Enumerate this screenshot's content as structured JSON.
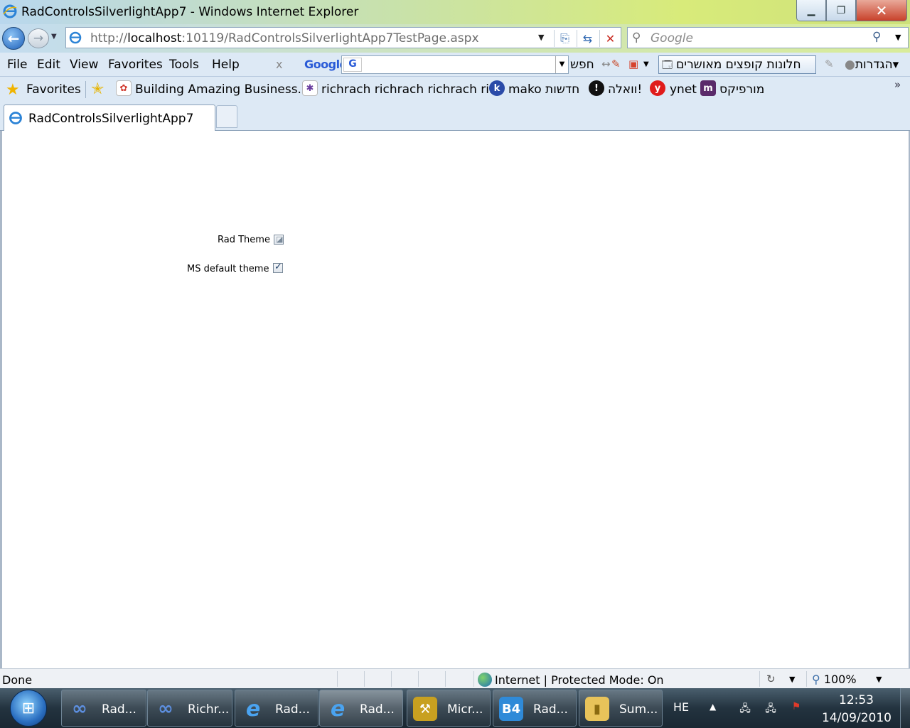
{
  "window": {
    "title": "RadControlsSilverlightApp7 - Windows Internet Explorer",
    "minimize_glyph": "▁",
    "maximize_glyph": "❐",
    "close_glyph": "✕"
  },
  "address_bar": {
    "url_prefix": "http://",
    "url_host": "localhost",
    "url_rest": ":10119/RadControlsSilverlightApp7TestPage.aspx",
    "search_placeholder": "Google"
  },
  "menu": {
    "items": [
      "File",
      "Edit",
      "View",
      "Favorites",
      "Tools",
      "Help"
    ]
  },
  "google_toolbar": {
    "close": "x",
    "logo": "Google",
    "search_label": "חפש",
    "popup_blocker": "חלונות קופצים מאושרים",
    "settings": "הגדרות"
  },
  "favorites_bar": {
    "label": "Favorites",
    "items": [
      {
        "label": "Building Amazing Business...",
        "icon": "page-icon",
        "color": "#d13a2f"
      },
      {
        "label": "richrach richrach richrach ri...",
        "icon": "puzzle-icon",
        "color": "#6b3fa0"
      },
      {
        "label": "mako חדשות",
        "icon": "mako-icon",
        "color": "#2a4aa8"
      },
      {
        "label": "וואלה!",
        "icon": "walla-icon",
        "color": "#111111"
      },
      {
        "label": "ynet",
        "icon": "ynet-icon",
        "color": "#e01b1b"
      },
      {
        "label": "מורפיקס",
        "icon": "morfix-icon",
        "color": "#5a2a6a"
      }
    ]
  },
  "tabs": [
    {
      "title": "RadControlsSilverlightApp7"
    }
  ],
  "content": {
    "options": [
      {
        "label": "Rad Theme",
        "checked": false
      },
      {
        "label": "MS default theme",
        "checked": true
      }
    ]
  },
  "status_bar": {
    "status": "Done",
    "zone": "Internet | Protected Mode: On",
    "zoom": "100%"
  },
  "taskbar": {
    "buttons": [
      {
        "label": "Rad...",
        "icon": "visual-studio-icon",
        "color": "#3d6fc4",
        "active": false
      },
      {
        "label": "Richr...",
        "icon": "visual-studio-icon",
        "color": "#3d6fc4",
        "active": false
      },
      {
        "label": "Rad...",
        "icon": "ie-icon",
        "color": "#2b83d6",
        "active": false
      },
      {
        "label": "Rad...",
        "icon": "ie-icon",
        "color": "#2b83d6",
        "active": true
      },
      {
        "label": "Micr...",
        "icon": "tools-icon",
        "color": "#c8a020",
        "active": false
      },
      {
        "label": "Rad...",
        "icon": "blend-icon",
        "color": "#2f8ad8",
        "active": false
      },
      {
        "label": "Sum...",
        "icon": "folder-icon",
        "color": "#e8c35a",
        "active": false
      }
    ],
    "language": "HE",
    "time": "12:53",
    "date": "14/09/2010"
  }
}
